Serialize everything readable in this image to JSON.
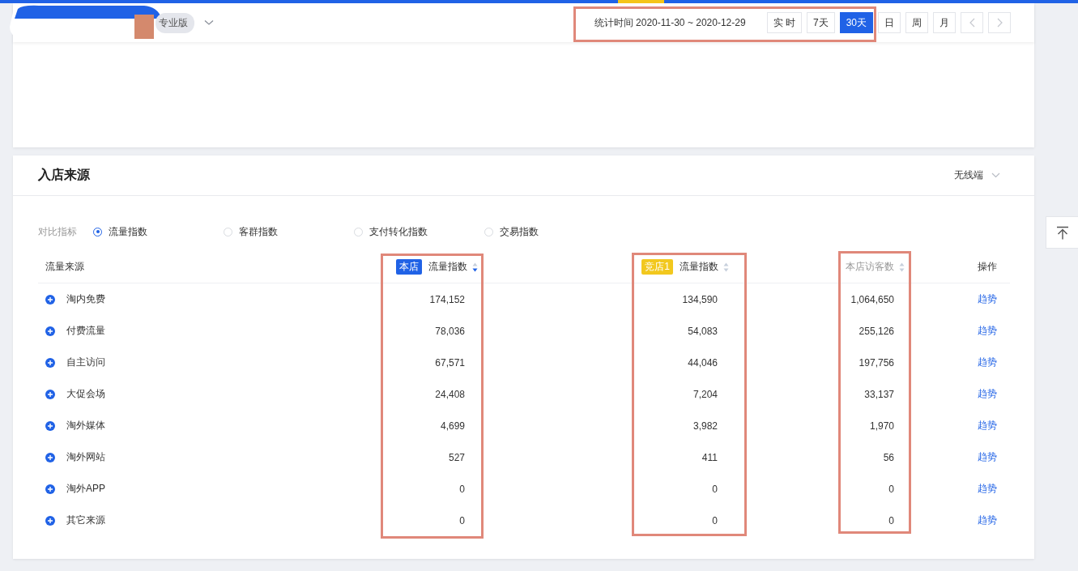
{
  "header": {
    "edition_badge": "专业版",
    "date_range": "统计时间 2020-11-30 ~ 2020-12-29",
    "periods": [
      {
        "label": "实 时",
        "selected": false
      },
      {
        "label": "7天",
        "selected": false
      },
      {
        "label": "30天",
        "selected": true
      },
      {
        "label": "日",
        "selected": false
      },
      {
        "label": "周",
        "selected": false
      },
      {
        "label": "月",
        "selected": false
      }
    ],
    "nav": [
      {
        "kind": "prev",
        "disabled": true
      },
      {
        "kind": "next",
        "disabled": true
      }
    ]
  },
  "section": {
    "title": "入店来源",
    "device": "无线端",
    "compare": {
      "label": "对比指标",
      "options": [
        {
          "label": "流量指数",
          "selected": true
        },
        {
          "label": "客群指数",
          "selected": false
        },
        {
          "label": "支付转化指数",
          "selected": false
        },
        {
          "label": "交易指数",
          "selected": false
        }
      ]
    },
    "table": {
      "columns": [
        {
          "kind": "text",
          "label": "流量来源"
        },
        {
          "kind": "sortable",
          "tag": "本店",
          "color": "#2062e6",
          "label": "流量指数",
          "sorted": true
        },
        {
          "kind": "sortable",
          "tag": "竞店1",
          "color": "#f2c81e",
          "label": "流量指数",
          "sorted": false
        },
        {
          "kind": "sortable",
          "label": "本店访客数",
          "sorted": false
        },
        {
          "kind": "text",
          "label": "操作"
        }
      ],
      "rows": [
        {
          "source": "淘内免费",
          "values": [
            "174,152",
            "134,590",
            "1,064,650"
          ],
          "action": "趋势"
        },
        {
          "source": "付费流量",
          "values": [
            "78,036",
            "54,083",
            "255,126"
          ],
          "action": "趋势"
        },
        {
          "source": "自主访问",
          "values": [
            "67,571",
            "44,046",
            "197,756"
          ],
          "action": "趋势"
        },
        {
          "source": "大促会场",
          "values": [
            "24,408",
            "7,204",
            "33,137"
          ],
          "action": "趋势"
        },
        {
          "source": "淘外媒体",
          "values": [
            "4,699",
            "3,982",
            "1,970"
          ],
          "action": "趋势"
        },
        {
          "source": "淘外网站",
          "values": [
            "527",
            "411",
            "56"
          ],
          "action": "趋势"
        },
        {
          "source": "淘外APP",
          "values": [
            "0",
            "0",
            "0"
          ],
          "action": "趋势"
        },
        {
          "source": "其它来源",
          "values": [
            "0",
            "0",
            "0"
          ],
          "action": "趋势"
        }
      ]
    }
  }
}
